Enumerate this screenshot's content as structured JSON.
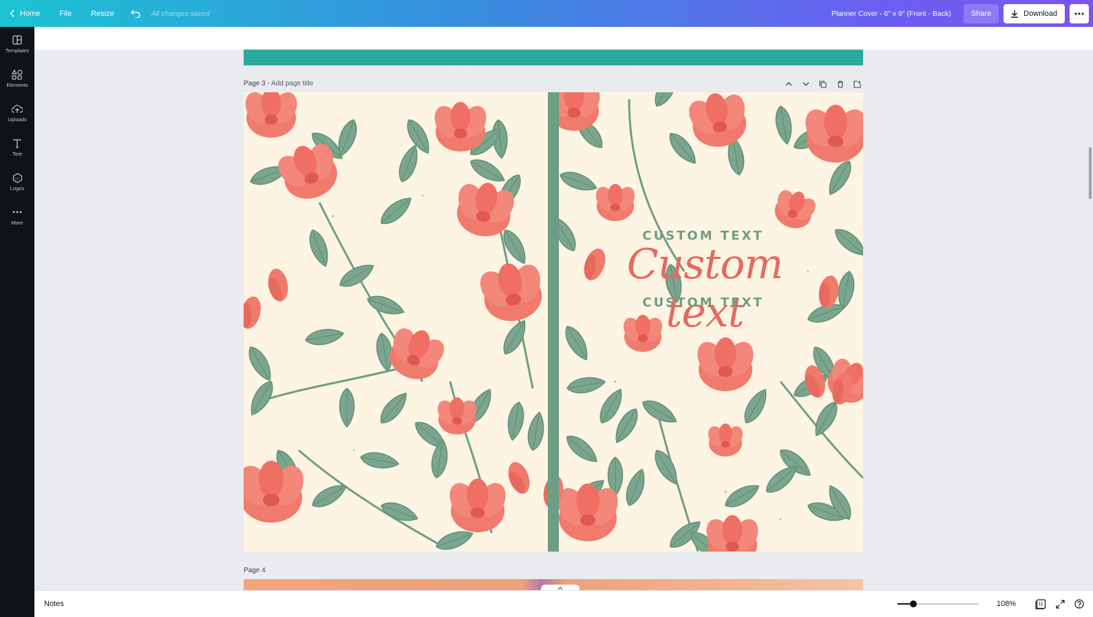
{
  "topbar": {
    "home_label": "Home",
    "file_label": "File",
    "resize_label": "Resize",
    "status": "All changes saved",
    "doc_title": "Planner Cover - 6\" x 9\" (Front - Back)",
    "share_label": "Share",
    "download_label": "Download"
  },
  "sidebar": {
    "items": [
      {
        "label": "Templates",
        "icon": "templates-icon"
      },
      {
        "label": "Elements",
        "icon": "elements-icon"
      },
      {
        "label": "Uploads",
        "icon": "uploads-icon"
      },
      {
        "label": "Text",
        "icon": "text-icon"
      },
      {
        "label": "Logos",
        "icon": "logos-icon"
      },
      {
        "label": "More",
        "icon": "more-icon"
      }
    ]
  },
  "pages": {
    "page3_label": "Page 3 - ",
    "page3_title_placeholder": "Add page title",
    "page4_label": "Page 4"
  },
  "design": {
    "top_text": "CUSTOM TEXT",
    "script_text": "Custom text",
    "bottom_text": "CUSTOM TEXT",
    "colors": {
      "background": "#fdf4e3",
      "leaf": "#6d9e84",
      "flower": "#f07a6c",
      "script": "#e46a5f"
    }
  },
  "bottombar": {
    "notes_label": "Notes",
    "zoom": "108%",
    "page_count": "11"
  },
  "theme": {
    "gradient_start": "#1cc3d3",
    "gradient_end": "#7a55ee",
    "sidebar_bg": "#0e1318"
  }
}
